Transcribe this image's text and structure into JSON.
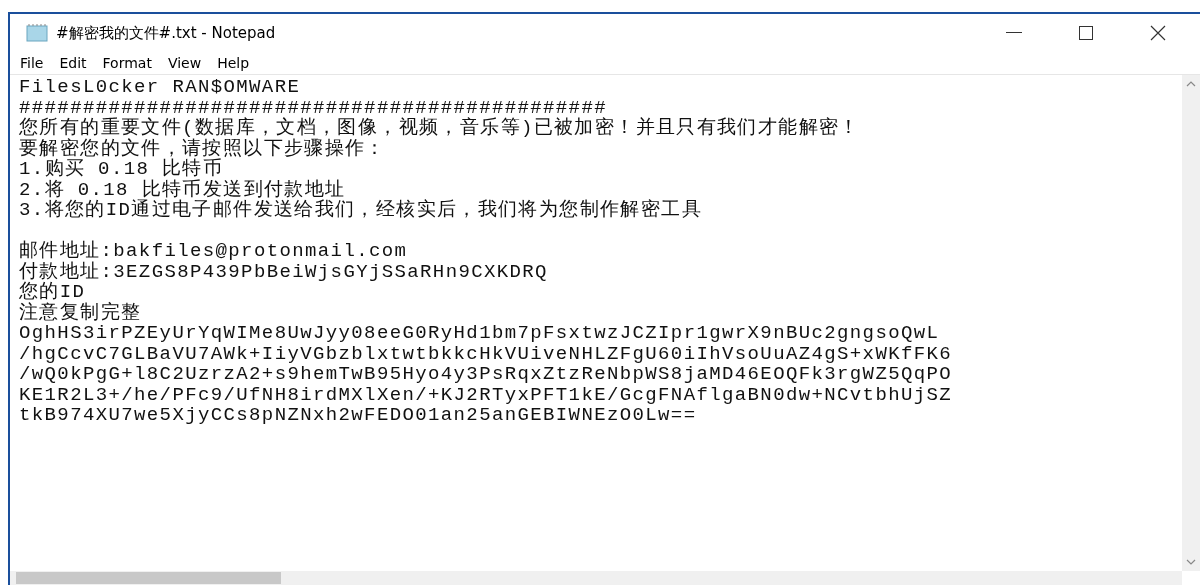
{
  "window": {
    "title": "#解密我的文件#.txt - Notepad"
  },
  "menu": [
    "File",
    "Edit",
    "Format",
    "View",
    "Help"
  ],
  "document": {
    "blocks": [
      [
        "FilesL0cker RAN$OMWARE",
        "##############################################",
        "您所有的重要文件(数据库，文档，图像，视频，音乐等)已被加密！并且只有我们才能解密！",
        "要解密您的文件，请按照以下步骤操作：",
        "1.购买 0.18 比特币",
        "2.将 0.18 比特币发送到付款地址",
        "3.将您的ID通过电子邮件发送给我们，经核实后，我们将为您制作解密工具"
      ],
      [
        "邮件地址:bakfiles@protonmail.com",
        "付款地址:3EZGS8P439PbBeiWjsGYjSSaRHn9CXKDRQ",
        "您的ID",
        "注意复制完整",
        "OghHS3irPZEyUrYqWIMe8UwJyy08eeG0RyHd1bm7pFsxtwzJCZIpr1gwrX9nBUc2gngsoQwL",
        "/hgCcvC7GLBaVU7AWk+IiyVGbzblxtwtbkkcHkVUiveNHLZFgU60iIhVsoUuAZ4gS+xWKfFK6",
        "/wQ0kPgG+l8C2UzrzA2+s9hemTwB95Hyo4y3PsRqxZtzReNbpWS8jaMD46EOQFk3rgWZ5QqPO",
        "KE1R2L3+/he/PFc9/UfNH8irdMXlXen/+KJ2RTyxPFT1kE/GcgFNAflgaBN0dw+NCvtbhUjSZ",
        "tkB974XU7we5XjyCCs8pNZNxh2wFEDO01an25anGEBIWNEzO0Lw=="
      ]
    ]
  }
}
